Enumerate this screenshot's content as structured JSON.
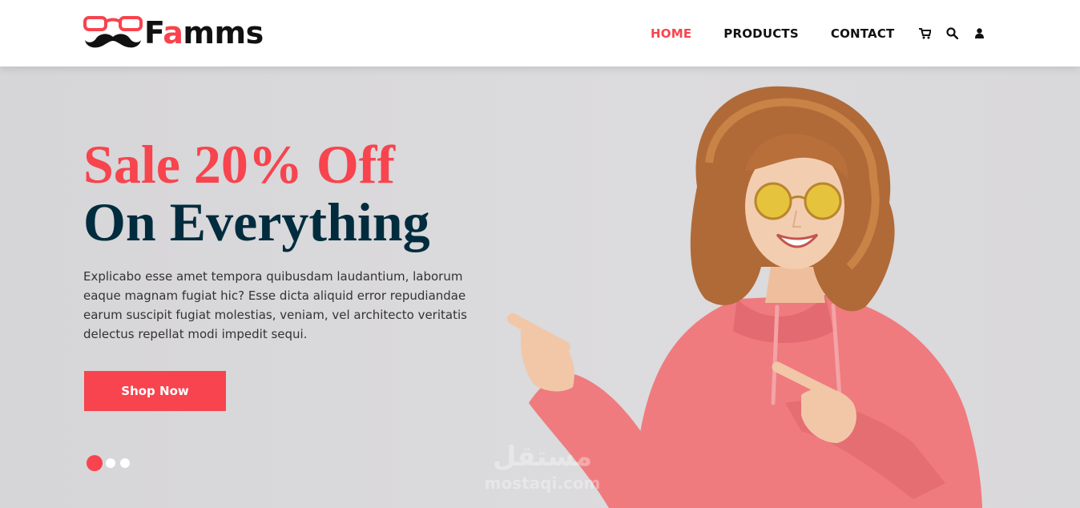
{
  "brand": {
    "logo_text_prefix": "F",
    "logo_text_accent": "a",
    "logo_text_suffix": "mms",
    "accent_color": "#f7444e",
    "dark_color": "#002c3e"
  },
  "nav": {
    "items": [
      {
        "label": "HOME",
        "active": true
      },
      {
        "label": "PRODUCTS",
        "active": false
      },
      {
        "label": "CONTACT",
        "active": false
      }
    ],
    "icons": [
      "cart-icon",
      "search-icon",
      "user-icon"
    ]
  },
  "hero": {
    "headline_line1": "Sale 20% Off",
    "headline_line2": "On Everything",
    "body": "Explicabo esse amet tempora quibusdam laudantium, laborum eaque magnam fugiat hic? Esse dicta aliquid error repudiandae earum suscipit fugiat molestias, veniam, vel architecto veritatis delectus repellat modi impedit sequi.",
    "cta_label": "Shop Now",
    "slides_count": 3,
    "active_slide": 1
  },
  "watermark": {
    "arabic": "مستقل",
    "latin": "mostaqi.com"
  }
}
